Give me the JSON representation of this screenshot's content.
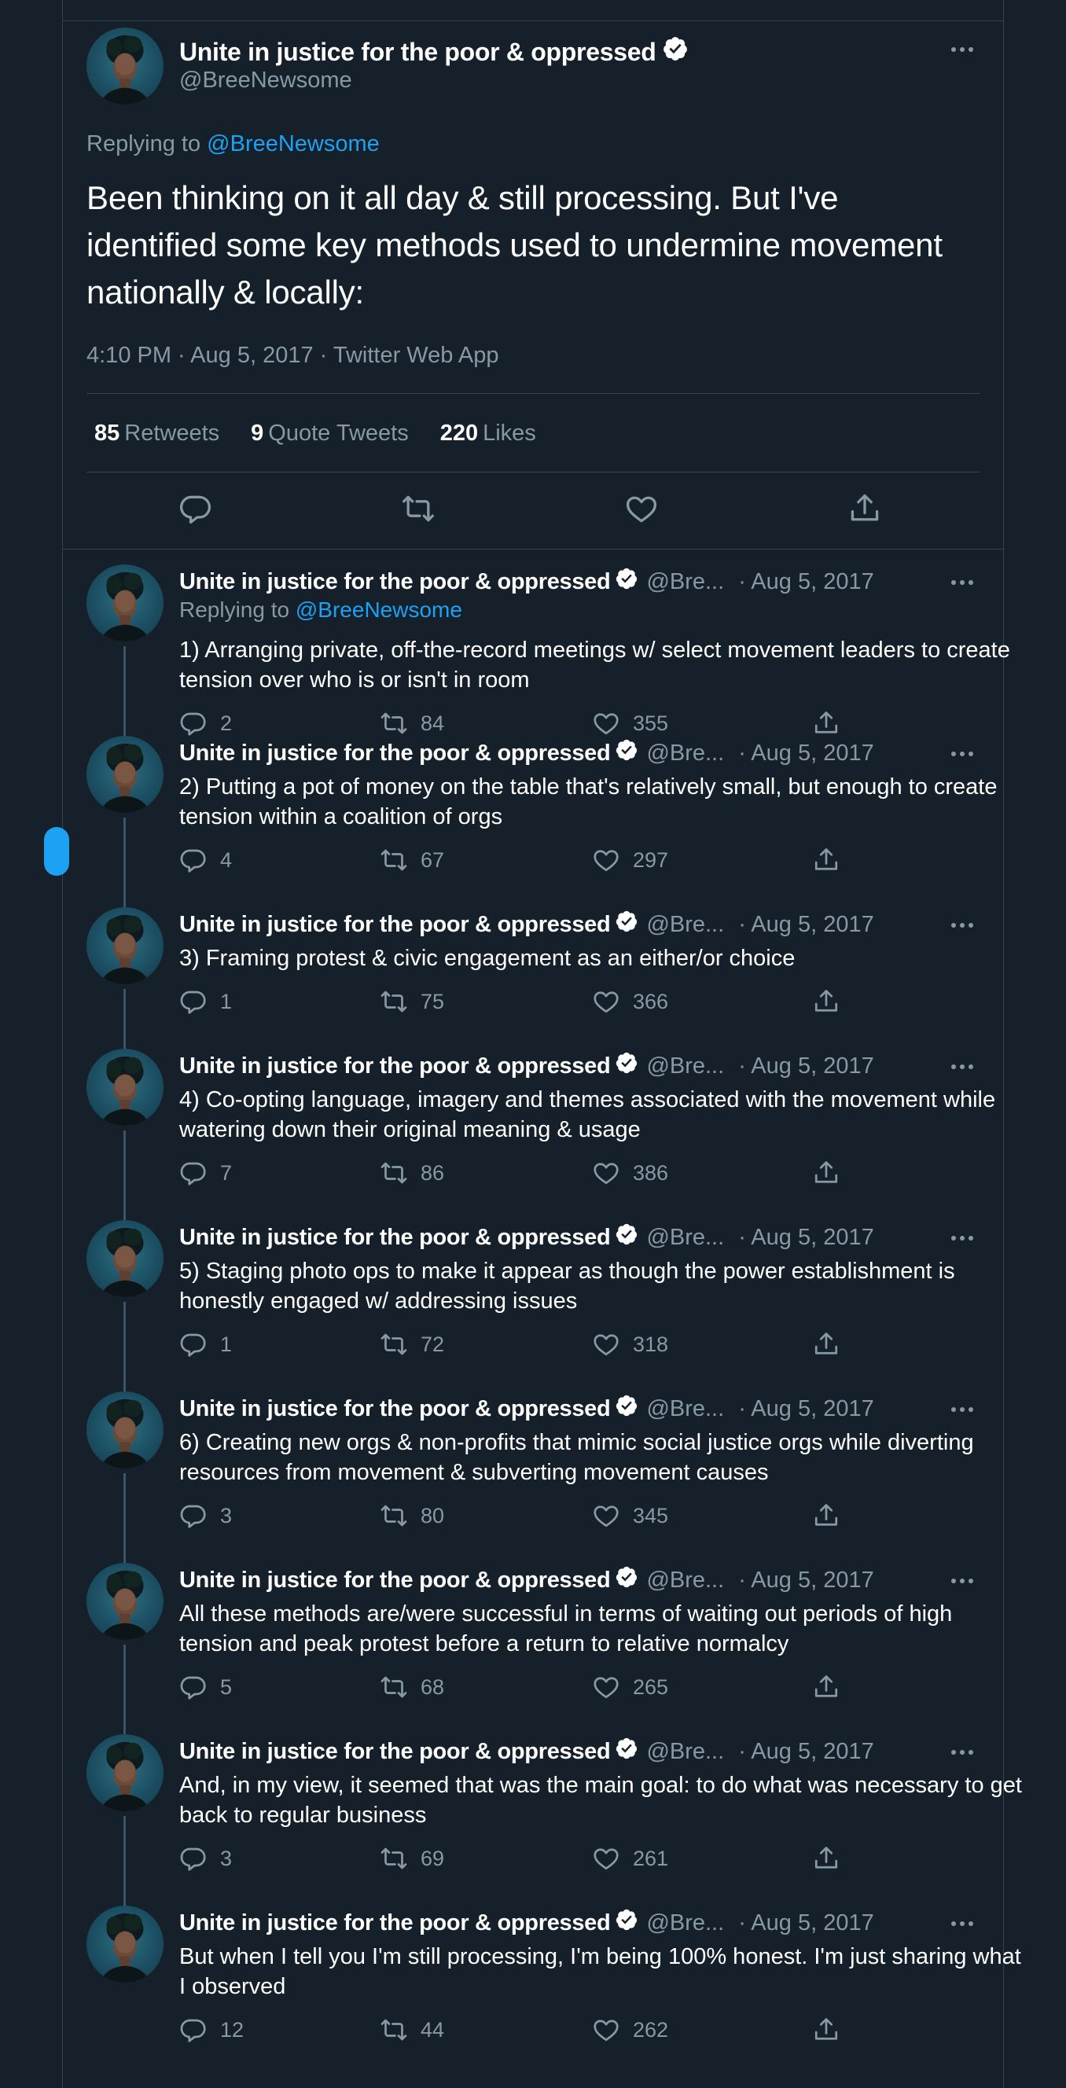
{
  "main": {
    "name": "Unite in justice for the poor & oppressed",
    "handle": "@BreeNewsome",
    "replying_prefix": "Replying to",
    "replying_to": "@BreeNewsome",
    "text": "Been thinking on it all day & still processing. But I've identified some key methods used to undermine movement nationally & locally:",
    "meta": "4:10 PM · Aug 5, 2017 · Twitter Web App",
    "retweets_count": "85",
    "retweets_label": "Retweets",
    "quotes_count": "9",
    "quotes_label": "Quote Tweets",
    "likes_count": "220",
    "likes_label": "Likes"
  },
  "thread": [
    {
      "name": "Unite in justice for the poor & oppressed",
      "handle": "@Bre...",
      "date": "· Aug 5, 2017",
      "replying_prefix": "Replying to",
      "replying_to": "@BreeNewsome",
      "text": "1) Arranging private, off-the-record meetings w/ select movement leaders to create tension over who is or isn't in room",
      "replies": "2",
      "retweets": "84",
      "likes": "355"
    },
    {
      "name": "Unite in justice for the poor & oppressed",
      "handle": "@Bre...",
      "date": "· Aug 5, 2017",
      "text": "2) Putting a pot of money on the table that's relatively small, but enough to create tension within a coalition of orgs",
      "replies": "4",
      "retweets": "67",
      "likes": "297"
    },
    {
      "name": "Unite in justice for the poor & oppressed",
      "handle": "@Bre...",
      "date": "· Aug 5, 2017",
      "text": "3) Framing protest & civic engagement as an either/or choice",
      "replies": "1",
      "retweets": "75",
      "likes": "366"
    },
    {
      "name": "Unite in justice for the poor & oppressed",
      "handle": "@Bre...",
      "date": "· Aug 5, 2017",
      "text": "4) Co-opting language, imagery and themes associated with the movement while watering down their original meaning & usage",
      "replies": "7",
      "retweets": "86",
      "likes": "386"
    },
    {
      "name": "Unite in justice for the poor & oppressed",
      "handle": "@Bre...",
      "date": "· Aug 5, 2017",
      "text": "5) Staging photo ops to make it appear as though the power establishment is honestly engaged w/ addressing issues",
      "replies": "1",
      "retweets": "72",
      "likes": "318"
    },
    {
      "name": "Unite in justice for the poor & oppressed",
      "handle": "@Bre...",
      "date": "· Aug 5, 2017",
      "text": "6) Creating new orgs & non-profits that mimic social justice orgs while diverting resources from movement & subverting movement causes",
      "replies": "3",
      "retweets": "80",
      "likes": "345"
    },
    {
      "name": "Unite in justice for the poor & oppressed",
      "handle": "@Bre...",
      "date": "· Aug 5, 2017",
      "text": "All these methods are/were successful in terms of waiting out periods of high tension and peak protest before a return to relative normalcy",
      "replies": "5",
      "retweets": "68",
      "likes": "265"
    },
    {
      "name": "Unite in justice for the poor & oppressed",
      "handle": "@Bre...",
      "date": "· Aug 5, 2017",
      "text": "And, in my view, it seemed that was the main goal: to do what was necessary to get back to regular business",
      "replies": "3",
      "retweets": "69",
      "likes": "261"
    },
    {
      "name": "Unite in justice for the poor & oppressed",
      "handle": "@Bre...",
      "date": "· Aug 5, 2017",
      "text": "But when I tell you I'm still processing, I'm being 100% honest. I'm just sharing what I observed",
      "replies": "12",
      "retweets": "44",
      "likes": "262"
    }
  ],
  "icons": {
    "verified": "verified-badge-icon",
    "more": "more-options-icon",
    "reply": "reply-icon",
    "retweet": "retweet-icon",
    "like": "like-icon",
    "share": "share-icon"
  },
  "colors": {
    "background": "#15202b",
    "border": "#38444d",
    "accent": "#1da1f2",
    "muted": "#8899a6",
    "text": "#ffffff"
  }
}
